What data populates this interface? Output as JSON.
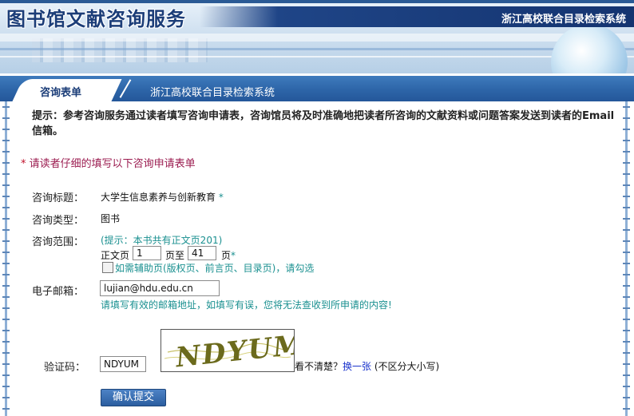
{
  "header": {
    "title": "图书馆文献咨询服务",
    "system_name": "浙江高校联合目录检索系统"
  },
  "nav": {
    "active_tab": "咨询表单",
    "breadcrumb": "浙江高校联合目录检索系统"
  },
  "notice": "提示：参考咨询服务通过读者填写咨询申请表，咨询馆员将及时准确地把读者所咨询的文献资料或问题答案发送到读者的Email信箱。",
  "required_note": {
    "star": "*",
    "text": "请读者仔细的填写以下咨询申请表单"
  },
  "form": {
    "title_label": "咨询标题：",
    "title_value": "大学生信息素养与创新教育",
    "title_star": "*",
    "type_label": "咨询类型：",
    "type_value": "图书",
    "range_label": "咨询范围：",
    "range_hint": "(提示：本书共有正文页201)",
    "range_prefix": "正文页",
    "range_from": "1",
    "range_mid": "页至",
    "range_to": "41",
    "range_suffix": "页",
    "range_star": "*",
    "aux_checkbox_label": "如需辅助页(版权页、前言页、目录页)，请勾选",
    "email_label": "电子邮箱：",
    "email_value": "lujian@hdu.edu.cn",
    "email_hint": "请填写有效的邮箱地址，如填写有误，您将无法查收到所申请的内容!",
    "captcha_label": "验证码：",
    "captcha_value": "NDYUM",
    "captcha_image_text": "NDYUM",
    "captcha_unclear": "看不清楚？",
    "captcha_refresh": "换一张",
    "captcha_case": "(不区分大小写)",
    "submit_label": "确认提交"
  },
  "colors": {
    "nav_blue": "#2d65a8",
    "required_red": "#9b1c50",
    "hint_teal": "#1a9090",
    "link_blue": "#1a33cc"
  }
}
